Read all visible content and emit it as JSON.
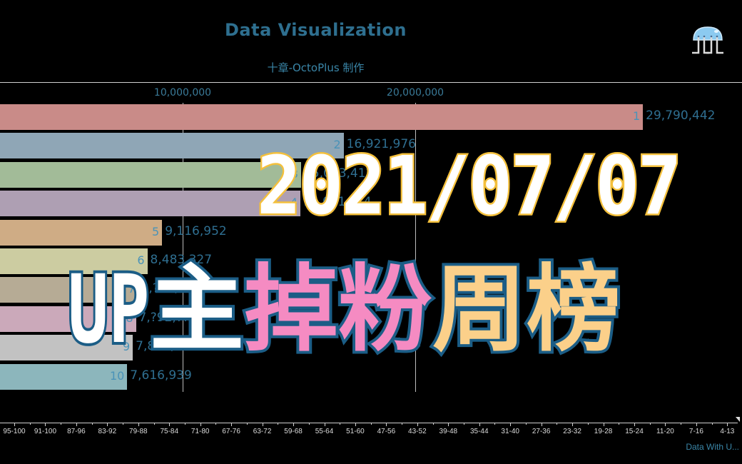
{
  "header": {
    "title": "Data Visualization",
    "subtitle": "十章-OctoPlus 制作",
    "logo_icon": "jellyfish-octoplus-logo"
  },
  "overlay": {
    "date": "2021/07/07",
    "headline_parts": [
      {
        "text": "UP",
        "color": "#ffffff"
      },
      {
        "text": "主",
        "color": "#ffffff"
      },
      {
        "text": "掉",
        "color": "#f58bc2"
      },
      {
        "text": "粉",
        "color": "#f58bc2"
      },
      {
        "text": "周",
        "color": "#fbd08a"
      },
      {
        "text": "榜",
        "color": "#fbd08a"
      }
    ]
  },
  "chart_data": {
    "type": "bar",
    "orientation": "horizontal",
    "title": "Data Visualization",
    "subtitle": "十章-OctoPlus 制作",
    "xlim": [
      0,
      31000000
    ],
    "x_ticks": [
      10000000,
      20000000
    ],
    "x_tick_labels": [
      "10,000,000",
      "20,000,000"
    ],
    "grid": true,
    "series": [
      {
        "rank": "1",
        "value": 29790442,
        "label": "29,790,442",
        "color": "#c98b88"
      },
      {
        "rank": "2",
        "value": 16921976,
        "label": "16,921,976",
        "color": "#8fa6b6"
      },
      {
        "rank": "3",
        "value": 15093410,
        "label": "15,093,41?",
        "color": "#a2bb98"
      },
      {
        "rank": "4",
        "value": 15061734,
        "label": "15,061,7?4",
        "color": "#ae9fb3"
      },
      {
        "rank": "5",
        "value": 9116952,
        "label": "9,116,952",
        "color": "#cfac85"
      },
      {
        "rank": "6",
        "value": 8483327,
        "label": "8,483,327",
        "color": "#cccca1"
      },
      {
        "rank": "7",
        "value": 8083000,
        "label": "8,?83,???",
        "color": "#b6ab95"
      },
      {
        "rank": "8",
        "value": 7992000,
        "label": "7,?92,???",
        "color": "#cba9ba"
      },
      {
        "rank": "9",
        "value": 7857626,
        "label": "7,857,626",
        "color": "#c2c2c2"
      },
      {
        "rank": "10",
        "value": 7616939,
        "label": "7,616,939",
        "color": "#8cb6bc"
      }
    ]
  },
  "timeline": {
    "labels": [
      "95-100",
      "91-100",
      "87-96",
      "83-92",
      "79-88",
      "75-84",
      "71-80",
      "67-76",
      "63-72",
      "59-68",
      "55-64",
      "51-60",
      "47-56",
      "43-52",
      "39-48",
      "35-44",
      "31-40",
      "27-36",
      "23-32",
      "19-28",
      "15-24",
      "11-20",
      "7-16",
      "4-13"
    ],
    "source_text": "Data With U..."
  }
}
